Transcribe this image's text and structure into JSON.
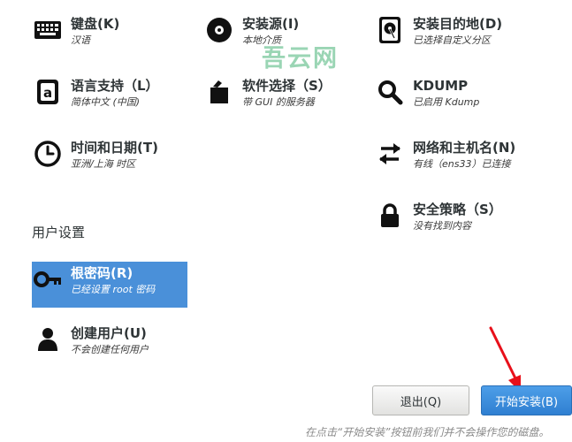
{
  "localization": {
    "keyboard": {
      "title": "键盘(K)",
      "status": "汉语",
      "icon": "keyboard-icon"
    },
    "language": {
      "title": "语言支持（L）",
      "status": "简体中文 (中国)",
      "icon": "language-icon"
    },
    "time": {
      "title": "时间和日期(T)",
      "status": "亚洲/上海 时区",
      "icon": "clock-icon"
    }
  },
  "software": {
    "source": {
      "title": "安装源(I)",
      "status": "本地介质",
      "icon": "disc-icon"
    },
    "selection": {
      "title": "软件选择（S）",
      "status": "带 GUI 的服务器",
      "icon": "package-icon"
    }
  },
  "system": {
    "destination": {
      "title": "安装目的地(D)",
      "status": "已选择自定义分区",
      "icon": "harddisk-icon"
    },
    "kdump": {
      "title": "KDUMP",
      "status": "已启用 Kdump",
      "icon": "search-icon"
    },
    "network": {
      "title": "网络和主机名(N)",
      "status": "有线（ens33）已连接",
      "icon": "network-icon"
    },
    "security": {
      "title": "安全策略（S）",
      "status": "没有找到内容",
      "icon": "lock-icon"
    }
  },
  "user_settings": {
    "section_title": "用户设置",
    "root": {
      "title": "根密码(R)",
      "status": "已经设置 root 密码",
      "icon": "key-icon"
    },
    "user": {
      "title": "创建用户(U)",
      "status": "不会创建任何用户",
      "icon": "user-icon"
    }
  },
  "buttons": {
    "quit": "退出(Q)",
    "begin": "开始安装(B)"
  },
  "footer_note": "在点击“开始安装”按钮前我们并不会操作您的磁盘。",
  "watermark": "吾云网",
  "colors": {
    "selected": "#4a90d9",
    "primary_button": "#3584e4",
    "arrow": "#e8101a"
  }
}
